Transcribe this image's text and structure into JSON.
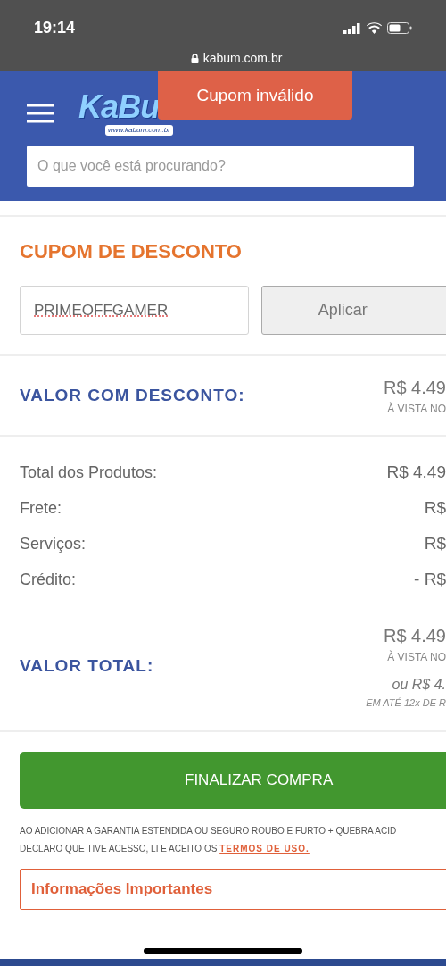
{
  "status_bar": {
    "time": "19:14",
    "url": "kabum.com.br"
  },
  "header": {
    "logo": "KaBu",
    "logo_sub": "www.kabum.com.br",
    "search": {
      "placeholder": "O que você está procurando?"
    }
  },
  "toast": {
    "text": "Cupom inválido"
  },
  "coupon": {
    "title": "CUPOM DE DESCONTO",
    "value": "PRIMEOFFGAMER",
    "button": "Aplicar"
  },
  "discount": {
    "label": "VALOR COM DESCONTO:",
    "amount": "R$ 4.49",
    "note": "À VISTA NO"
  },
  "summary": [
    {
      "label": "Total dos Produtos:",
      "value": "R$ 4.49"
    },
    {
      "label": "Frete:",
      "value": "R$"
    },
    {
      "label": "Serviços:",
      "value": "R$"
    },
    {
      "label": "Crédito:",
      "value": "- R$"
    }
  ],
  "total": {
    "label": "VALOR TOTAL:",
    "amount": "R$ 4.49",
    "note": "À VISTA NO",
    "installment": "ou R$ 4.",
    "installment_note": "EM ATÉ 12x DE R"
  },
  "checkout_button": "FINALIZAR COMPRA",
  "terms": {
    "line1": "AO ADICIONAR A GARANTIA ESTENDIDA OU SEGURO ROUBO E FURTO + QUEBRA ACID",
    "line2": "DECLARO QUE TIVE ACESSO, LI E ACEITO OS",
    "link": "TERMOS DE USO."
  },
  "info_panel": "Informações Importantes"
}
